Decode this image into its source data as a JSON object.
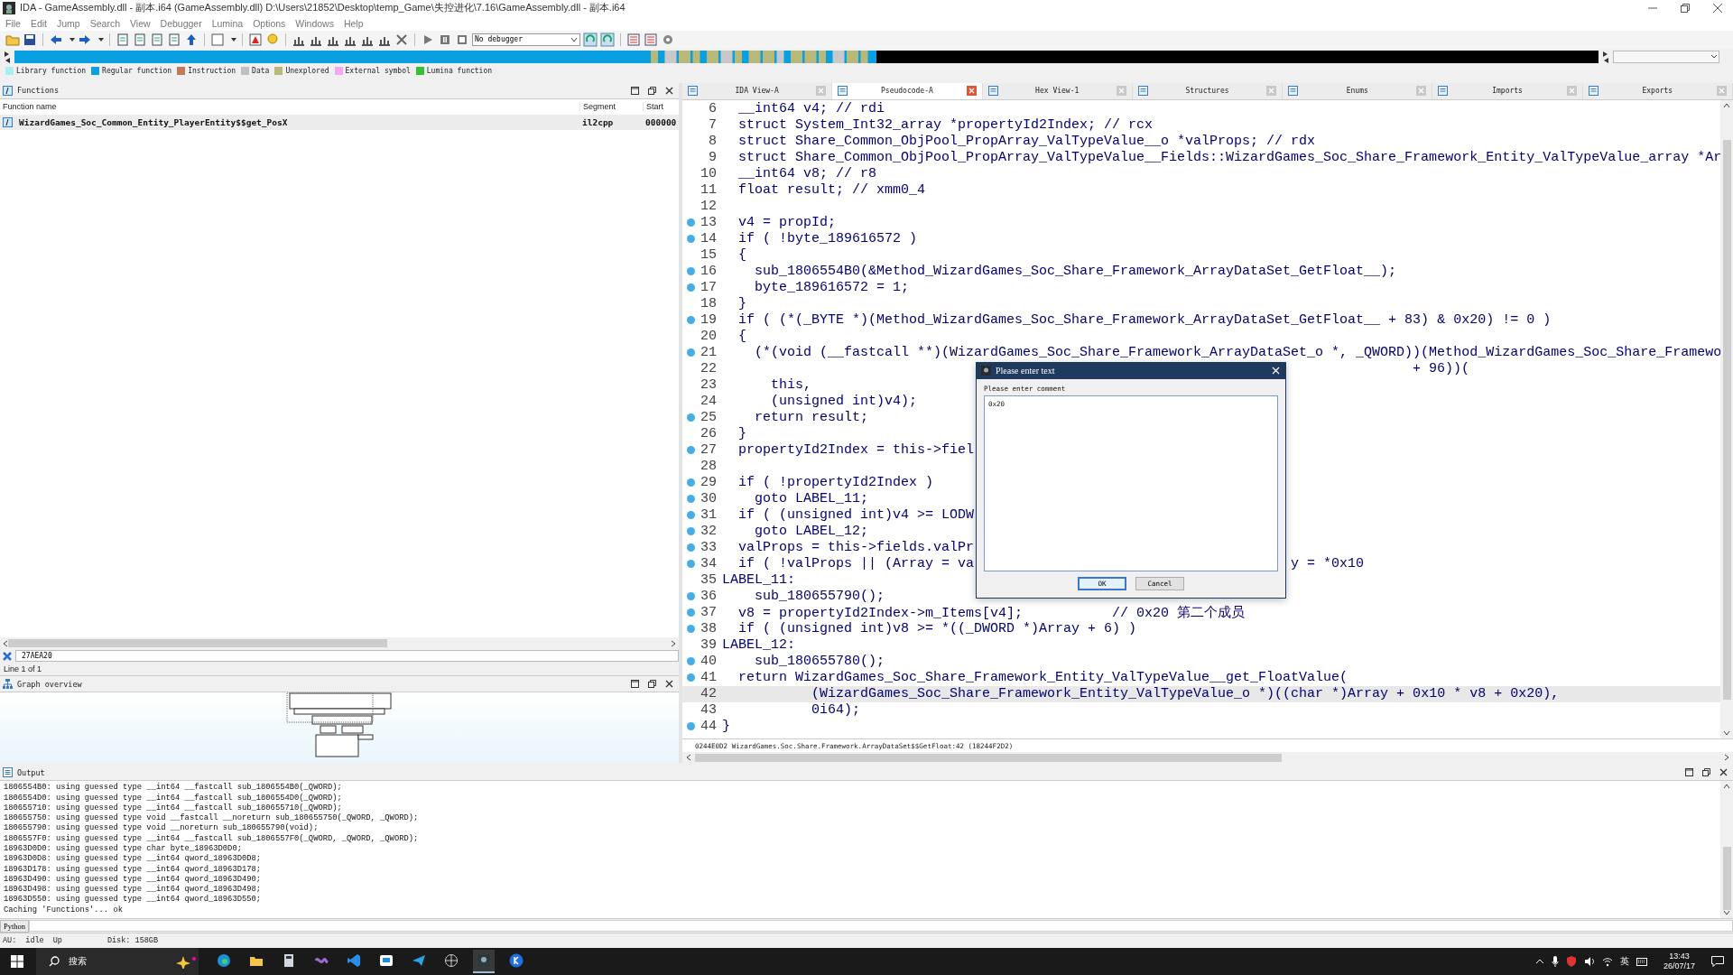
{
  "window": {
    "title": "IDA - GameAssembly.dll - 副本.i64 (GameAssembly.dll) D:\\Users\\21852\\Desktop\\temp_Game\\失控进化\\7.16\\GameAssembly.dll - 副本.i64"
  },
  "menu": [
    "File",
    "Edit",
    "Jump",
    "Search",
    "View",
    "Debugger",
    "Lumina",
    "Options",
    "Windows",
    "Help"
  ],
  "toolbar": {
    "debugger": "No debugger"
  },
  "legend": [
    {
      "label": "Library function",
      "color": "#a8f0f0"
    },
    {
      "label": "Regular function",
      "color": "#0a9fe0"
    },
    {
      "label": "Instruction",
      "color": "#c07a5a"
    },
    {
      "label": "Data",
      "color": "#c0c0c0"
    },
    {
      "label": "Unexplored",
      "color": "#b8b878"
    },
    {
      "label": "External symbol",
      "color": "#f4a8f0"
    },
    {
      "label": "Lumina function",
      "color": "#33c033"
    }
  ],
  "functions": {
    "title": "Functions",
    "columns": [
      "Function name",
      "Segment",
      "Start"
    ],
    "rows": [
      {
        "name": "WizardGames_Soc_Common_Entity_PlayerEntity$$get_PosX",
        "segment": "il2cpp",
        "start": "000000",
        "selected": true
      }
    ],
    "filter": "27AEA20",
    "line_info": "Line 1 of 1"
  },
  "graph_overview": {
    "title": "Graph overview"
  },
  "tabs": [
    {
      "label": "IDA View-A",
      "selected": false
    },
    {
      "label": "Pseudocode-A",
      "selected": true
    },
    {
      "label": "Hex View-1",
      "selected": false
    },
    {
      "label": "Structures",
      "selected": false
    },
    {
      "label": "Enums",
      "selected": false
    },
    {
      "label": "Imports",
      "selected": false
    },
    {
      "label": "Exports",
      "selected": false
    }
  ],
  "pseudocode": {
    "lines": [
      {
        "number": "6",
        "text": "  __int64 v4; // rdi",
        "breakpoint": false,
        "current": false
      },
      {
        "number": "7",
        "text": "  struct System_Int32_array *propertyId2Index; // rcx",
        "breakpoint": false,
        "current": false
      },
      {
        "number": "8",
        "text": "  struct Share_Common_ObjPool_PropArray_ValTypeValue__o *valProps; // rdx",
        "breakpoint": false,
        "current": false
      },
      {
        "number": "9",
        "text": "  struct Share_Common_ObjPool_PropArray_ValTypeValue__Fields::WizardGames_Soc_Share_Framework_Entity_ValTypeValue_array *Ar",
        "breakpoint": false,
        "current": false
      },
      {
        "number": "10",
        "text": "  __int64 v8; // r8",
        "breakpoint": false,
        "current": false
      },
      {
        "number": "11",
        "text": "  float result; // xmm0_4",
        "breakpoint": false,
        "current": false
      },
      {
        "number": "12",
        "breakpoint": false,
        "current": false
      },
      {
        "number": "13",
        "text": "  v4 = propId;",
        "breakpoint": true,
        "current": false
      },
      {
        "number": "14",
        "text": "  if ( !byte_189616572 )",
        "breakpoint": true,
        "current": false
      },
      {
        "number": "15",
        "text": "  {",
        "breakpoint": false,
        "current": false
      },
      {
        "number": "16",
        "text": "    sub_1806554B0(&Method_WizardGames_Soc_Share_Framework_ArrayDataSet_GetFloat__);",
        "breakpoint": true,
        "current": false
      },
      {
        "number": "17",
        "text": "    byte_189616572 = 1;",
        "breakpoint": true,
        "current": false
      },
      {
        "number": "18",
        "text": "  }",
        "breakpoint": false,
        "current": false
      },
      {
        "number": "19",
        "text": "  if ( (*(_BYTE *)(Method_WizardGames_Soc_Share_Framework_ArrayDataSet_GetFloat__ + 83) & 0x20) != 0 )",
        "breakpoint": true,
        "current": false
      },
      {
        "number": "20",
        "text": "  {",
        "breakpoint": false,
        "current": false
      },
      {
        "number": "21",
        "text": "    (*(void (__fastcall **)(WizardGames_Soc_Share_Framework_ArrayDataSet_o *, _QWORD))(Method_WizardGames_Soc_Share_Framewo",
        "breakpoint": true,
        "current": false
      },
      {
        "number": "22",
        "text": "                                                                                     + 96))(",
        "breakpoint": false,
        "current": false
      },
      {
        "number": "23",
        "text": "      this,",
        "breakpoint": false,
        "current": false
      },
      {
        "number": "24",
        "text": "      (unsigned int)v4);",
        "breakpoint": false,
        "current": false
      },
      {
        "number": "25",
        "text": "    return result;",
        "breakpoint": true,
        "current": false
      },
      {
        "number": "26",
        "text": "  }",
        "breakpoint": false,
        "current": false
      },
      {
        "number": "27",
        "text": "  propertyId2Index = this->fiel",
        "breakpoint": true,
        "current": false
      },
      {
        "number": "28",
        "breakpoint": false,
        "current": false
      },
      {
        "number": "29",
        "text": "  if ( !propertyId2Index )",
        "breakpoint": true,
        "current": false
      },
      {
        "number": "30",
        "text": "    goto LABEL_11;",
        "breakpoint": true,
        "current": false
      },
      {
        "number": "31",
        "text": "  if ( (unsigned int)v4 >= LODW",
        "breakpoint": true,
        "current": false
      },
      {
        "number": "32",
        "text": "    goto LABEL_12;",
        "breakpoint": true,
        "current": false
      },
      {
        "number": "33",
        "text": "  valProps = this->fields.valPr",
        "breakpoint": true,
        "current": false
      },
      {
        "number": "34",
        "text": "  if ( !valProps || (Array = va",
        "tail": "y = *0x10",
        "breakpoint": true,
        "current": false
      },
      {
        "number": "35",
        "text": "LABEL_11:",
        "breakpoint": false,
        "current": false
      },
      {
        "number": "36",
        "text": "    sub_180655790();",
        "breakpoint": true,
        "current": false
      },
      {
        "number": "37",
        "text": "  v8 = propertyId2Index->m_Items[v4];           // 0x20 第二个成员",
        "breakpoint": true,
        "current": false
      },
      {
        "number": "38",
        "text": "  if ( (unsigned int)v8 >= *((_DWORD *)Array + 6) )",
        "breakpoint": true,
        "current": false
      },
      {
        "number": "39",
        "text": "LABEL_12:",
        "breakpoint": false,
        "current": false
      },
      {
        "number": "40",
        "text": "    sub_180655780();",
        "breakpoint": true,
        "current": false
      },
      {
        "number": "41",
        "text": "  return WizardGames_Soc_Share_Framework_Entity_ValTypeValue__get_FloatValue(",
        "breakpoint": true,
        "current": false
      },
      {
        "number": "42",
        "text": "           (WizardGames_Soc_Share_Framework_Entity_ValTypeValue_o *)((char *)Array + 0x10 * v8 + 0x20),",
        "breakpoint": false,
        "current": true
      },
      {
        "number": "43",
        "text": "           0i64);",
        "breakpoint": false,
        "current": false
      },
      {
        "number": "44",
        "text": "}",
        "breakpoint": true,
        "current": false
      }
    ],
    "status": "0244E0D2 WizardGames.Soc.Share.Framework.ArrayDataSet$$GetFloat:42 (18244F2D2)"
  },
  "dialog": {
    "title": "Please enter text",
    "label": "Please enter comment",
    "value": "0x20",
    "buttons": [
      {
        "label": "OK",
        "default": true
      },
      {
        "label": "Cancel",
        "default": false
      }
    ]
  },
  "output": {
    "title": "Output",
    "lines": [
      "1806554B0: using guessed type __int64 __fastcall sub_1806554B0(_QWORD);",
      "1806554D0: using guessed type __int64 __fastcall sub_1806554D0(_QWORD);",
      "180655710: using guessed type __int64 __fastcall sub_180655710(_QWORD);",
      "180655750: using guessed type void __fastcall __noreturn sub_180655750(_QWORD, _QWORD);",
      "180655790: using guessed type void __noreturn sub_180655790(void);",
      "1806557F0: using guessed type __int64 __fastcall sub_1806557F0(_QWORD, _QWORD, _QWORD);",
      "18963D0D0: using guessed type char byte_18963D0D0;",
      "18963D0D8: using guessed type __int64 qword_18963D0D8;",
      "18963D178: using guessed type __int64 qword_18963D178;",
      "18963D490: using guessed type __int64 qword_18963D490;",
      "18963D498: using guessed type __int64 qword_18963D498;",
      "18963D550: using guessed type __int64 qword_18963D550;",
      "Caching 'Functions'... ok"
    ],
    "prompt": "Python"
  },
  "status_bar": {
    "label": "AU:",
    "state": "idle",
    "direction": "Up",
    "disk": "Disk: 158GB"
  },
  "taskbar": {
    "search": "搜索",
    "input_method": "英",
    "time": "13:43",
    "date": "26/07/17"
  }
}
